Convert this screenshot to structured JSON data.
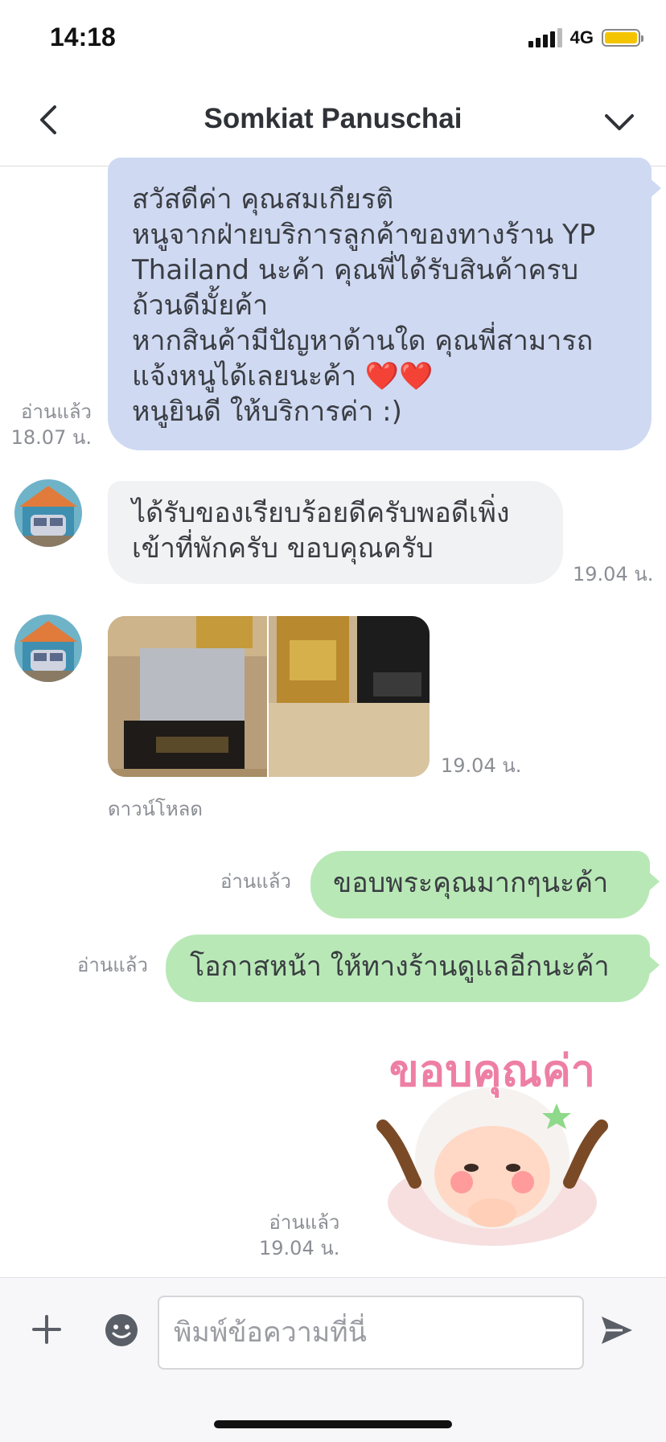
{
  "status_bar": {
    "time": "14:18",
    "network": "4G"
  },
  "header": {
    "title": "Somkiat Panuschai"
  },
  "messages": {
    "m1": {
      "lines": [
        "สวัสดีค่า คุณสมเกียรติ",
        "หนูจากฝ่ายบริการลูกค้าของทางร้าน YP",
        "Thailand  นะค้า คุณพี่ได้รับสินค้าครบ",
        "ถ้วนดีมั้ยค้า",
        "หากสินค้ามีปัญหาด้านใด คุณพี่สามารถ",
        "แจ้งหนูได้เลยนะค้า ❤️❤️",
        "หนูยินดี ให้บริการค่า :)"
      ],
      "read": "อ่านแล้ว",
      "time": "18.07 น."
    },
    "m2": {
      "lines": [
        "ได้รับของเรียบร้อยดีครับพอดีเพิ่ง",
        "เข้าที่พักครับ ขอบคุณครับ"
      ],
      "time": "19.04 น."
    },
    "m3": {
      "time": "19.04 น.",
      "download": "ดาวน์โหลด"
    },
    "m4": {
      "text": "ขอบพระคุณมากๆนะค้า",
      "read": "อ่านแล้ว"
    },
    "m5": {
      "text": "โอกาสหน้า ให้ทางร้านดูแลอีกนะค้า",
      "read": "อ่านแล้ว"
    },
    "m6": {
      "sticker_text": "ขอบคุณค่า",
      "read": "อ่านแล้ว",
      "time": "19.04 น."
    }
  },
  "input": {
    "placeholder": "พิมพ์ข้อความที่นี่"
  },
  "colors": {
    "sent_blue": "#cfd9f2",
    "received": "#f1f2f4",
    "sent_green": "#b8e8b6",
    "battery": "#f5c400"
  },
  "icons": [
    "back-chevron-icon",
    "dropdown-chevron-icon",
    "plus-icon",
    "emoji-icon",
    "send-icon"
  ]
}
